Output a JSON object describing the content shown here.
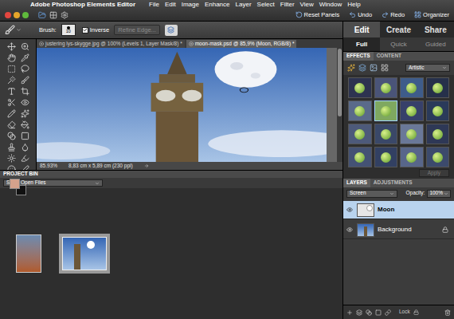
{
  "window": {
    "title": "Adobe Photoshop Elements Editor"
  },
  "menu": [
    "File",
    "Edit",
    "Image",
    "Enhance",
    "Layer",
    "Select",
    "Filter",
    "View",
    "Window",
    "Help"
  ],
  "toolbar_buttons": [
    "Reset Panels",
    "Undo",
    "Redo",
    "Organizer"
  ],
  "options_bar": {
    "brush_label": "Brush:",
    "brush_size": "10",
    "inverse": {
      "label": "Inverse",
      "checked": true
    },
    "refine_edge": {
      "label": "Refine Edge...",
      "disabled": true
    }
  },
  "swatches": [
    {
      "color": "#d4a28c"
    },
    {
      "color": "#111111"
    }
  ],
  "documents": [
    {
      "title": "justering lys-skygge.jpg @ 100% (Levels 1, Layer Mask/8) *",
      "selected": false
    },
    {
      "title": "moon-mask.psd @ 85,9% (Moon, RGB/8) *",
      "selected": true
    }
  ],
  "status_bar": {
    "zoom": "85.93%",
    "info": "8,83 cm x 5,89 cm (230 ppi)"
  },
  "project_bin": {
    "title": "PROJECT BIN",
    "filter": "Show Open Files",
    "thumbnails": [
      {
        "kind": "portrait",
        "selected": false
      },
      {
        "kind": "landscape",
        "selected": true
      }
    ]
  },
  "panel_tabs": [
    {
      "label": "Edit",
      "selected": true
    },
    {
      "label": "Create",
      "selected": false
    },
    {
      "label": "Share",
      "selected": false
    }
  ],
  "mode_tabs": [
    {
      "label": "Full",
      "selected": true
    },
    {
      "label": "Quick",
      "selected": false
    },
    {
      "label": "Guided",
      "selected": false
    }
  ],
  "effects": {
    "tabs": [
      {
        "label": "EFFECTS",
        "selected": true
      },
      {
        "label": "CONTENT",
        "selected": false
      }
    ],
    "category": "Artistic",
    "thumbnails": [
      {
        "selected": false
      },
      {
        "selected": false
      },
      {
        "selected": false
      },
      {
        "selected": false
      },
      {
        "selected": false
      },
      {
        "selected": true
      },
      {
        "selected": false
      },
      {
        "selected": false
      },
      {
        "selected": false
      },
      {
        "selected": false
      },
      {
        "selected": false
      },
      {
        "selected": false
      },
      {
        "selected": false
      },
      {
        "selected": false
      },
      {
        "selected": false
      },
      {
        "selected": false
      }
    ],
    "apply": {
      "label": "Apply",
      "disabled": true
    }
  },
  "layers_panel": {
    "tabs": [
      {
        "label": "LAYERS",
        "selected": true
      },
      {
        "label": "ADJUSTMENTS",
        "selected": false
      }
    ],
    "blend_mode": "Screen",
    "opacity_label": "Opacity:",
    "opacity": "100%",
    "layers": [
      {
        "name": "Moon",
        "visible": true,
        "selected": true,
        "locked": false,
        "kind": "mask"
      },
      {
        "name": "Background",
        "visible": true,
        "selected": false,
        "locked": true,
        "kind": "photo"
      }
    ],
    "lock_label": "Lock"
  }
}
